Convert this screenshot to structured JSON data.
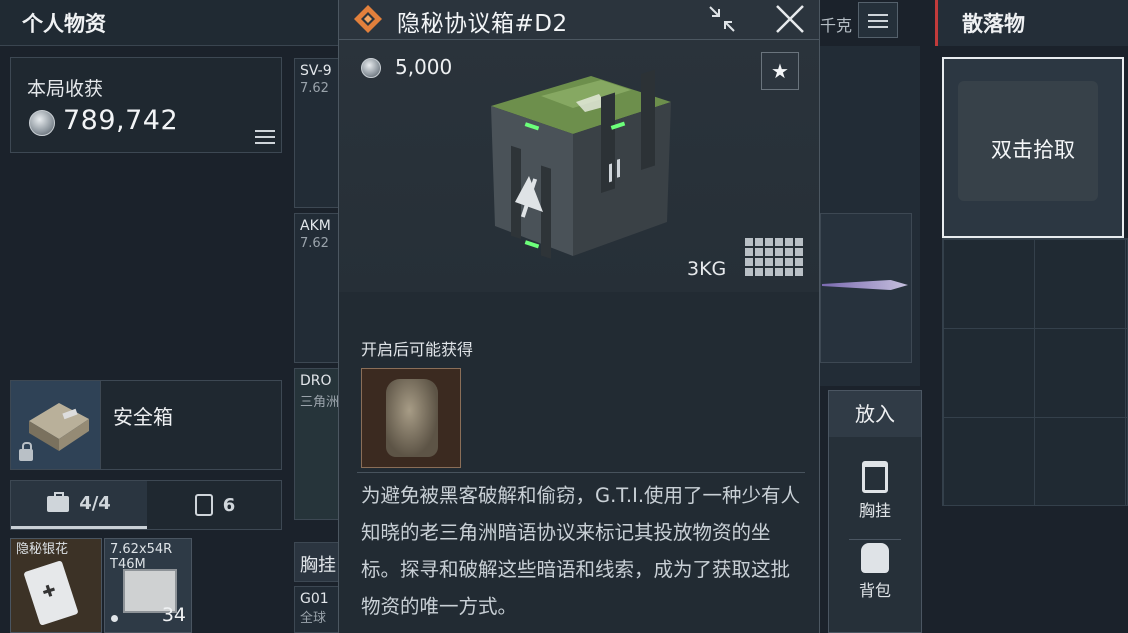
{
  "left_panel": {
    "title": "个人物资",
    "harvest_label": "本局收获",
    "harvest_value": "789,742",
    "safebox_label": "安全箱",
    "tabs": [
      {
        "count": "4/4",
        "icon": "briefcase-icon"
      },
      {
        "count": "6",
        "icon": "vest-icon"
      }
    ],
    "slots": [
      {
        "name": "隐秘银花",
        "image": "card-icon"
      },
      {
        "name": "7.62x54R T46M",
        "count": "34",
        "image": "ammo-box-icon"
      }
    ]
  },
  "middle_column": {
    "items": [
      {
        "line1": "SV-9",
        "line2": "7.62"
      },
      {
        "line1": "AKM",
        "line2": "7.62"
      },
      {
        "line1": "DRO",
        "line2": "三角洲"
      },
      {
        "line1": "胸挂",
        "line2": ""
      },
      {
        "line1": "G01",
        "line2": "全球"
      }
    ]
  },
  "header_right": {
    "weight_text": "千克"
  },
  "modal": {
    "title": "隐秘协议箱#D2",
    "price": "5,000",
    "weight": "3KG",
    "obtain_label": "开启后可能获得",
    "description": "为避免被黑客破解和偷窃，G.T.I.使用了一种少有人知晓的老三角洲暗语协议来标记其投放物资的坐标。探寻和破解这些暗语和线索，成为了获取这批物资的唯一方式。",
    "obtain_items": [
      {
        "icon": "backpack-icon"
      }
    ],
    "size_cells": 24
  },
  "place_panel": {
    "title": "放入",
    "items": [
      {
        "label": "胸挂",
        "icon": "chest-rig-icon"
      },
      {
        "label": "背包",
        "icon": "backpack-icon"
      }
    ]
  },
  "loot_panel": {
    "title": "散落物",
    "pickup_label": "双击拾取"
  },
  "colors": {
    "background": "#1b222b",
    "modal": "#222b33",
    "accent_orange": "#e2803c",
    "loot_accent": "#c23b3b",
    "crate_green": "#7fa25a"
  }
}
